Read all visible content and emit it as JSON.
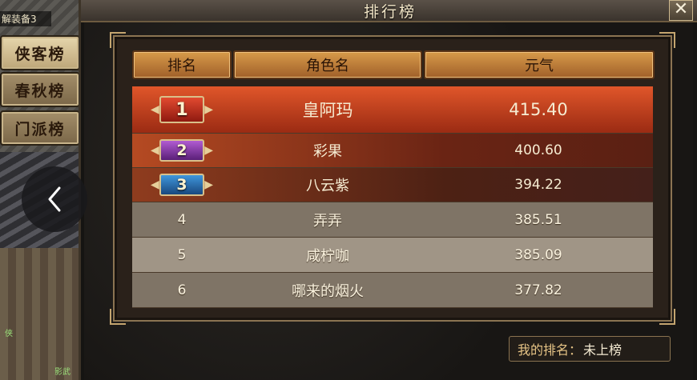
{
  "scene": {
    "top_text": "解装备3",
    "labels": [
      "侠",
      "影武"
    ]
  },
  "side_tabs": [
    {
      "label": "侠客榜",
      "active": true
    },
    {
      "label": "春秋榜",
      "active": false
    },
    {
      "label": "门派榜",
      "active": false
    }
  ],
  "dialog": {
    "title": "排行榜",
    "close_glyph": "✕"
  },
  "table": {
    "headers": {
      "rank": "排名",
      "name": "角色名",
      "value": "元气"
    },
    "rows": [
      {
        "rank": "1",
        "name": "皇阿玛",
        "value": "415.40"
      },
      {
        "rank": "2",
        "name": "彩果",
        "value": "400.60"
      },
      {
        "rank": "3",
        "name": "八云紫",
        "value": "394.22"
      },
      {
        "rank": "4",
        "name": "弄弄",
        "value": "385.51"
      },
      {
        "rank": "5",
        "name": "咸柠咖",
        "value": "385.09"
      },
      {
        "rank": "6",
        "name": "哪来的烟火",
        "value": "377.82"
      }
    ]
  },
  "my_rank": {
    "label": "我的排名：",
    "value": "未上榜"
  },
  "colors": {
    "gold": "#c4a56f",
    "rank1": "#e0562a",
    "rank2": "#b15cd2",
    "rank3": "#3f96dc"
  }
}
